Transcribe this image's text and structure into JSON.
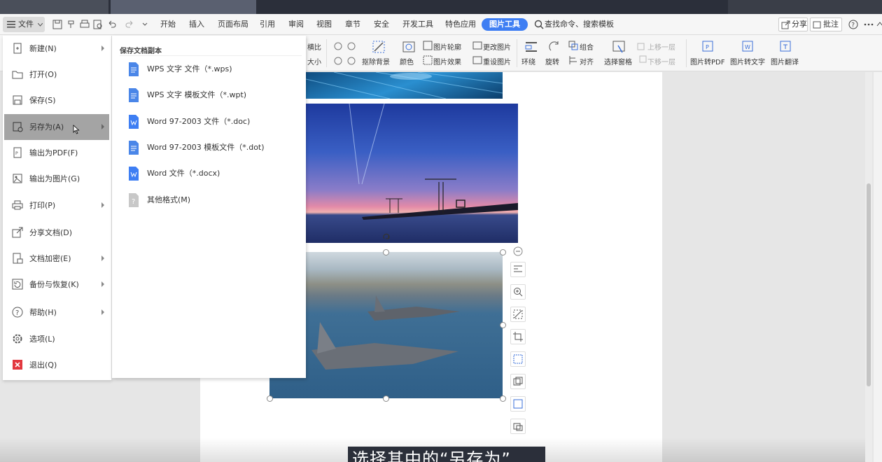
{
  "menubar": {
    "file_label": "文件",
    "tabs": [
      "开始",
      "插入",
      "页面布局",
      "引用",
      "审阅",
      "视图",
      "章节",
      "安全",
      "开发工具",
      "特色应用",
      "图片工具"
    ],
    "active_tab": "图片工具",
    "search_text": "查找命令、搜索模板",
    "share_label": "分享",
    "annotate_label": "批注"
  },
  "ribbon": {
    "crop_ratio": "横比",
    "size": "大小",
    "remove_bg": "抠除背景",
    "color": "颜色",
    "outline": "图片轮廓",
    "effect": "图片效果",
    "change_pic": "更改图片",
    "reset_pic": "重设图片",
    "wrap": "环绕",
    "rotate": "旋转",
    "group": "组合",
    "align": "对齐",
    "selection_pane": "选择窗格",
    "bring_forward": "上移一层",
    "send_backward": "下移一层",
    "to_pdf": "图片转PDF",
    "to_text": "图片转文字",
    "translate": "图片翻译"
  },
  "file_menu": {
    "items": [
      {
        "label": "新建(N)",
        "arrow": true
      },
      {
        "label": "打开(O)",
        "arrow": false
      },
      {
        "label": "保存(S)",
        "arrow": false
      },
      {
        "label": "另存为(A)",
        "arrow": true
      },
      {
        "label": "输出为PDF(F)",
        "arrow": false
      },
      {
        "label": "输出为图片(G)",
        "arrow": false
      },
      {
        "label": "打印(P)",
        "arrow": true
      },
      {
        "label": "分享文档(D)",
        "arrow": false
      },
      {
        "label": "文档加密(E)",
        "arrow": true
      },
      {
        "label": "备份与恢复(K)",
        "arrow": true
      },
      {
        "label": "帮助(H)",
        "arrow": true
      },
      {
        "label": "选项(L)",
        "arrow": false
      },
      {
        "label": "退出(Q)",
        "arrow": false
      }
    ]
  },
  "save_as_submenu": {
    "title": "保存文档副本",
    "items": [
      {
        "label": "WPS 文字 文件（*.wps)",
        "icon": "wps-doc-icon"
      },
      {
        "label": "WPS 文字 模板文件（*.wpt)",
        "icon": "wps-template-icon"
      },
      {
        "label": "Word 97-2003 文件（*.doc)",
        "icon": "word-doc-icon"
      },
      {
        "label": "Word 97-2003 模板文件（*.dot)",
        "icon": "word-template-icon"
      },
      {
        "label": "Word 文件（*.docx)",
        "icon": "word-docx-icon"
      },
      {
        "label": "其他格式(M)",
        "icon": "unknown-format-icon"
      }
    ]
  },
  "caption": {
    "text": "选择其中的“另存为”"
  },
  "colors": {
    "accent": "#3e7ef3",
    "highlight": "#a4a4a4",
    "titlebar": "#2b2f3a"
  }
}
